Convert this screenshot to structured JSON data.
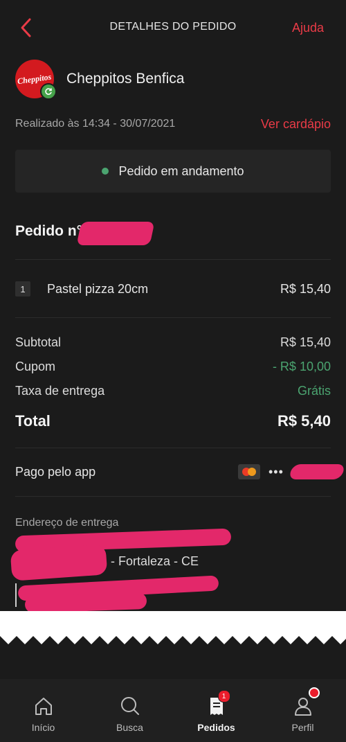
{
  "header": {
    "title": "DETALHES DO PEDIDO",
    "help": "Ajuda"
  },
  "store": {
    "name": "Cheppitos Benfica",
    "logo_text": "Cheppitos"
  },
  "meta": {
    "date": "Realizado às 14:34 - 30/07/2021",
    "menu_link": "Ver cardápio"
  },
  "status": {
    "text": "Pedido em andamento",
    "color": "#4ba470"
  },
  "order": {
    "label": "Pedido n°"
  },
  "items": [
    {
      "qty": "1",
      "name": "Pastel pizza 20cm",
      "price": "R$ 15,40"
    }
  ],
  "summary": {
    "subtotal_label": "Subtotal",
    "subtotal_value": "R$ 15,40",
    "coupon_label": "Cupom",
    "coupon_value": "- R$ 10,00",
    "fee_label": "Taxa de entrega",
    "fee_value": "Grátis",
    "total_label": "Total",
    "total_value": "R$ 5,40"
  },
  "payment": {
    "label": "Pago pelo app",
    "card_dots": "•••",
    "card_icon": "mastercard-icon"
  },
  "address": {
    "label": "Endereço de entrega",
    "city": "- Fortaleza - CE"
  },
  "nav": {
    "items": [
      {
        "label": "Início",
        "icon": "home-icon"
      },
      {
        "label": "Busca",
        "icon": "search-icon"
      },
      {
        "label": "Pedidos",
        "icon": "orders-icon",
        "badge": "1"
      },
      {
        "label": "Perfil",
        "icon": "profile-icon"
      }
    ]
  },
  "colors": {
    "accent": "#ea3b47",
    "background": "#1b1b1b",
    "positive": "#4ba470",
    "redaction": "#e3286a"
  }
}
